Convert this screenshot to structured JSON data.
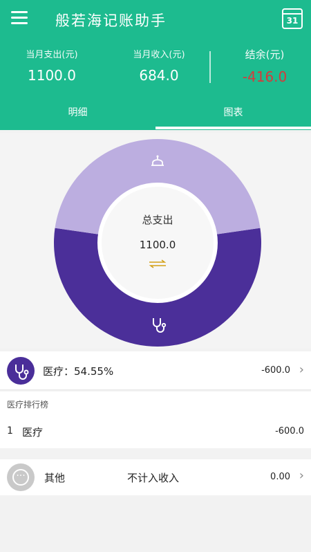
{
  "app": {
    "title": "般若海记账助手"
  },
  "calendar": {
    "day": "31",
    "icon": "calendar-icon"
  },
  "menu": {
    "icon": "menu-icon"
  },
  "summary": {
    "expense_label": "当月支出(元)",
    "expense_value": "1100.0",
    "income_label": "当月收入(元)",
    "income_value": "684.0",
    "balance_label": "结余(元)",
    "balance_value": "-416.0",
    "balance_color": "#d63a3a"
  },
  "tabs": [
    {
      "label": "明细",
      "active": false
    },
    {
      "label": "图表",
      "active": true
    }
  ],
  "donut": {
    "center_label": "总支出",
    "center_value": "1100.0",
    "swap_icon": "swap-arrows-icon"
  },
  "chart_data": {
    "type": "pie",
    "series": [
      {
        "name": "医疗",
        "value": 600.0,
        "percent": 54.55,
        "color": "#4b2f99",
        "icon": "stethoscope-icon"
      },
      {
        "name": "",
        "value": 500.0,
        "percent": 45.45,
        "color": "#bcaee0",
        "icon": "cake-icon"
      }
    ]
  },
  "selected_category": {
    "label": "医疗：54.55%",
    "amount": "-600.0",
    "icon": "stethoscope-icon"
  },
  "ranking": {
    "title": "医疗排行榜",
    "items": [
      {
        "rank": "1",
        "name": "医疗",
        "amount": "-600.0"
      }
    ]
  },
  "other": {
    "label": "其他",
    "note": "不计入收入",
    "amount": "0.00",
    "icon": "more-icon"
  },
  "colors": {
    "primary": "#1dbb8f",
    "accent": "#4b2f99",
    "accent_light": "#bcaee0"
  }
}
